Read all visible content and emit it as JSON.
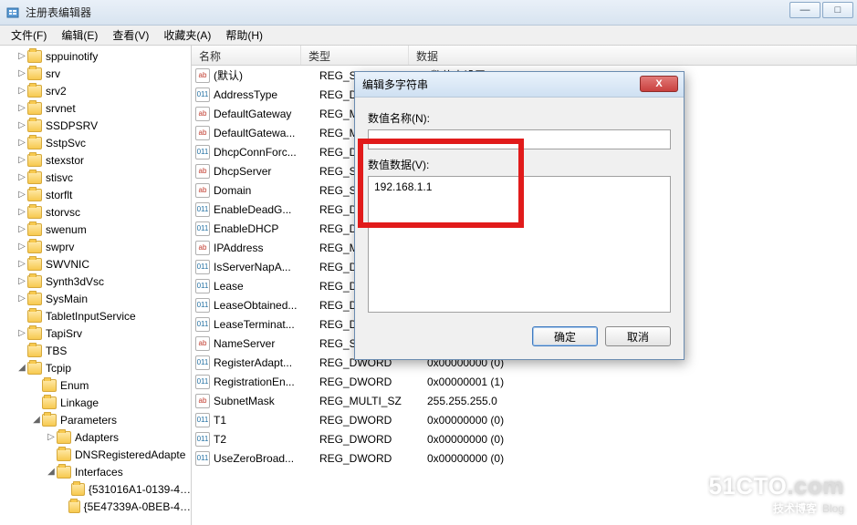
{
  "window": {
    "title": "注册表编辑器",
    "minimize": "—",
    "maximize": "□"
  },
  "menubar": [
    "文件(F)",
    "编辑(E)",
    "查看(V)",
    "收藏夹(A)",
    "帮助(H)"
  ],
  "tree": [
    {
      "depth": 1,
      "exp": "▷",
      "label": "sppuinotify"
    },
    {
      "depth": 1,
      "exp": "▷",
      "label": "srv"
    },
    {
      "depth": 1,
      "exp": "▷",
      "label": "srv2"
    },
    {
      "depth": 1,
      "exp": "▷",
      "label": "srvnet"
    },
    {
      "depth": 1,
      "exp": "▷",
      "label": "SSDPSRV"
    },
    {
      "depth": 1,
      "exp": "▷",
      "label": "SstpSvc"
    },
    {
      "depth": 1,
      "exp": "▷",
      "label": "stexstor"
    },
    {
      "depth": 1,
      "exp": "▷",
      "label": "stisvc"
    },
    {
      "depth": 1,
      "exp": "▷",
      "label": "storflt"
    },
    {
      "depth": 1,
      "exp": "▷",
      "label": "storvsc"
    },
    {
      "depth": 1,
      "exp": "▷",
      "label": "swenum"
    },
    {
      "depth": 1,
      "exp": "▷",
      "label": "swprv"
    },
    {
      "depth": 1,
      "exp": "▷",
      "label": "SWVNIC"
    },
    {
      "depth": 1,
      "exp": "▷",
      "label": "Synth3dVsc"
    },
    {
      "depth": 1,
      "exp": "▷",
      "label": "SysMain"
    },
    {
      "depth": 1,
      "exp": " ",
      "label": "TabletInputService"
    },
    {
      "depth": 1,
      "exp": "▷",
      "label": "TapiSrv"
    },
    {
      "depth": 1,
      "exp": " ",
      "label": "TBS"
    },
    {
      "depth": 1,
      "exp": "◢",
      "label": "Tcpip"
    },
    {
      "depth": 2,
      "exp": " ",
      "label": "Enum"
    },
    {
      "depth": 2,
      "exp": " ",
      "label": "Linkage"
    },
    {
      "depth": 2,
      "exp": "◢",
      "label": "Parameters"
    },
    {
      "depth": 3,
      "exp": "▷",
      "label": "Adapters"
    },
    {
      "depth": 3,
      "exp": " ",
      "label": "DNSRegisteredAdapte"
    },
    {
      "depth": 3,
      "exp": "◢",
      "label": "Interfaces"
    },
    {
      "depth": 4,
      "exp": " ",
      "label": "{531016A1-0139-4…"
    },
    {
      "depth": 4,
      "exp": " ",
      "label": "{5E47339A-0BEB-4…"
    }
  ],
  "columns": {
    "name": "名称",
    "type": "类型",
    "data": "数据"
  },
  "values": [
    {
      "icon": "str",
      "name": "(默认)",
      "type": "REG_SZ",
      "data": "(数值未设置)"
    },
    {
      "icon": "bin",
      "name": "AddressType",
      "type": "REG_D",
      "data": ""
    },
    {
      "icon": "str",
      "name": "DefaultGateway",
      "type": "REG_M",
      "data": ""
    },
    {
      "icon": "str",
      "name": "DefaultGatewa...",
      "type": "REG_M",
      "data": ""
    },
    {
      "icon": "bin",
      "name": "DhcpConnForc...",
      "type": "REG_D",
      "data": ""
    },
    {
      "icon": "str",
      "name": "DhcpServer",
      "type": "REG_S",
      "data": ""
    },
    {
      "icon": "str",
      "name": "Domain",
      "type": "REG_S",
      "data": ""
    },
    {
      "icon": "bin",
      "name": "EnableDeadG...",
      "type": "REG_D",
      "data": ""
    },
    {
      "icon": "bin",
      "name": "EnableDHCP",
      "type": "REG_D",
      "data": ""
    },
    {
      "icon": "str",
      "name": "IPAddress",
      "type": "REG_M",
      "data": ""
    },
    {
      "icon": "bin",
      "name": "IsServerNapA...",
      "type": "REG_D",
      "data": ""
    },
    {
      "icon": "bin",
      "name": "Lease",
      "type": "REG_D",
      "data": ""
    },
    {
      "icon": "bin",
      "name": "LeaseObtained...",
      "type": "REG_D",
      "data": ""
    },
    {
      "icon": "bin",
      "name": "LeaseTerminat...",
      "type": "REG_D",
      "data": ""
    },
    {
      "icon": "str",
      "name": "NameServer",
      "type": "REG_S",
      "data": ""
    },
    {
      "icon": "bin",
      "name": "RegisterAdapt...",
      "type": "REG_DWORD",
      "data": "0x00000000 (0)"
    },
    {
      "icon": "bin",
      "name": "RegistrationEn...",
      "type": "REG_DWORD",
      "data": "0x00000001 (1)"
    },
    {
      "icon": "str",
      "name": "SubnetMask",
      "type": "REG_MULTI_SZ",
      "data": "255.255.255.0"
    },
    {
      "icon": "bin",
      "name": "T1",
      "type": "REG_DWORD",
      "data": "0x00000000 (0)"
    },
    {
      "icon": "bin",
      "name": "T2",
      "type": "REG_DWORD",
      "data": "0x00000000 (0)"
    },
    {
      "icon": "bin",
      "name": "UseZeroBroad...",
      "type": "REG_DWORD",
      "data": "0x00000000 (0)"
    }
  ],
  "dialog": {
    "title": "编辑多字符串",
    "name_label": "数值名称(N):",
    "name_value": "",
    "data_label": "数值数据(V):",
    "data_value": "192.168.1.1",
    "ok": "确定",
    "cancel": "取消",
    "close": "X"
  },
  "watermark": {
    "main_a": "51CTO",
    "main_b": ".com",
    "sub_a": "技术博客",
    "sub_b": "Blog"
  }
}
